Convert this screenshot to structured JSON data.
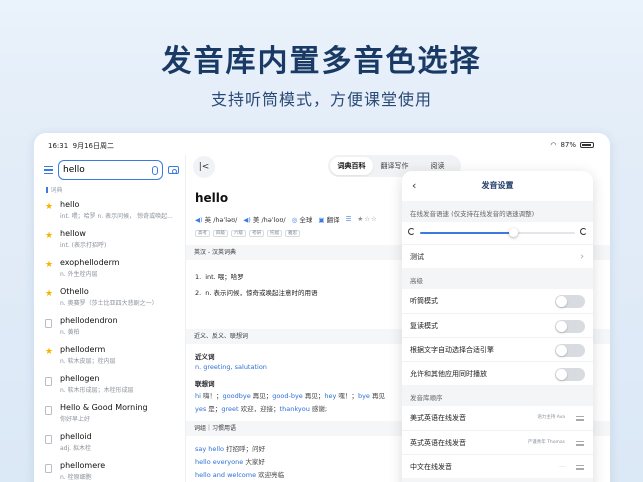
{
  "promo": {
    "headline": "发音库内置多音色选择",
    "subhead": "支持听筒模式，方便课堂使用"
  },
  "status_bar": {
    "time": "16:31",
    "date": "9月16日周二",
    "battery": "87%"
  },
  "search": {
    "value": "hello",
    "section_label": "词典"
  },
  "word_list": [
    {
      "word": "hello",
      "desc": "int. 喂；哈罗  n. 表示问候， 惊奇或唤起...",
      "icon": "star-icon"
    },
    {
      "word": "hellow",
      "desc": "int. (表示打招呼)",
      "icon": "star-icon"
    },
    {
      "word": "exophelloderm",
      "desc": "n. 外生栓内层",
      "icon": "star-icon"
    },
    {
      "word": "Othello",
      "desc": "n. 奥赛罗（莎士比亚四大悲剧之一）",
      "icon": "star-icon"
    },
    {
      "word": "phellodendron",
      "desc": "n. 黄柏",
      "icon": "doc-icon"
    },
    {
      "word": "phelloderm",
      "desc": "n. 软木皮层；栓内层",
      "icon": "star-icon"
    },
    {
      "word": "phellogen",
      "desc": "n. 软木形成层；木栓形成层",
      "icon": "doc-icon"
    },
    {
      "word": "Hello & Good Morning",
      "desc": "你好早上好",
      "icon": "doc-icon"
    },
    {
      "word": "phelloid",
      "desc": "adj. 拟木栓",
      "icon": "doc-icon"
    },
    {
      "word": "phellomere",
      "desc": "n. 栓原细胞",
      "icon": "doc-icon"
    }
  ],
  "main_tabs": [
    "词典百科",
    "翻译写作",
    "阅读"
  ],
  "entry": {
    "word": "hello",
    "pron_uk": "英 /həˈləʊ/",
    "pron_us": "美 /həˈloʊ/",
    "global": "全球",
    "translate": "翻译",
    "tags": [
      "高考",
      "四级",
      "六级",
      "考研",
      "托福",
      "雅思"
    ],
    "block1_title": "英汉 - 汉英词典",
    "def1": "int. 喂；哈罗",
    "def2": "n. 表示问候，惊奇或唤起注意时的用语",
    "block2_title": "近义、反义、联想词",
    "syn_label": "近义词",
    "syn_words": "n. greeting, salutation",
    "assoc_label": "联想词",
    "assoc_line1": [
      {
        "t": "hi",
        "c": "bl"
      },
      {
        "t": " 嗨！；",
        "c": "gr"
      },
      {
        "t": "goodbye",
        "c": "bl"
      },
      {
        "t": " 再见；",
        "c": "gr"
      },
      {
        "t": "good-bye",
        "c": "bl"
      },
      {
        "t": " 再见；",
        "c": "gr"
      },
      {
        "t": "hey",
        "c": "bl"
      },
      {
        "t": " 嘿！；",
        "c": "gr"
      },
      {
        "t": "bye",
        "c": "bl"
      },
      {
        "t": " 再见",
        "c": "gr"
      }
    ],
    "assoc_line2": [
      {
        "t": "yes",
        "c": "bl"
      },
      {
        "t": " 是；",
        "c": "gr"
      },
      {
        "t": "greet",
        "c": "bl"
      },
      {
        "t": " 欢迎，迎接；",
        "c": "gr"
      },
      {
        "t": "thankyou",
        "c": "bl"
      },
      {
        "t": " 感谢;",
        "c": "gr"
      }
    ],
    "block3_title": "词组｜习惯用语",
    "phrases": [
      {
        "en": "say hello",
        "zh": "打招呼；问好"
      },
      {
        "en": "hello everyone",
        "zh": "大家好"
      },
      {
        "en": "hello and welcome",
        "zh": "欢迎亮临"
      }
    ]
  },
  "settings": {
    "title": "发音设置",
    "speed_label": "在线发音语速 (仅支持在线发音的语速调整)",
    "speed_value": 0.6,
    "test_label": "测试",
    "advanced_label": "高级",
    "toggles": [
      {
        "label": "听筒模式",
        "on": false
      },
      {
        "label": "复读模式",
        "on": false
      },
      {
        "label": "根据文字自动选择合适引擎",
        "on": false
      },
      {
        "label": "允许和其他应用同时播放",
        "on": false
      }
    ],
    "order_label": "发音库顺序",
    "engines": [
      {
        "label": "美式英语在线发音",
        "speaker": "语力主持 Ava"
      },
      {
        "label": "英式英语在线发音",
        "speaker": "严谨青年 Thomas"
      },
      {
        "label": "中文在线发音",
        "speaker": "...."
      }
    ]
  }
}
